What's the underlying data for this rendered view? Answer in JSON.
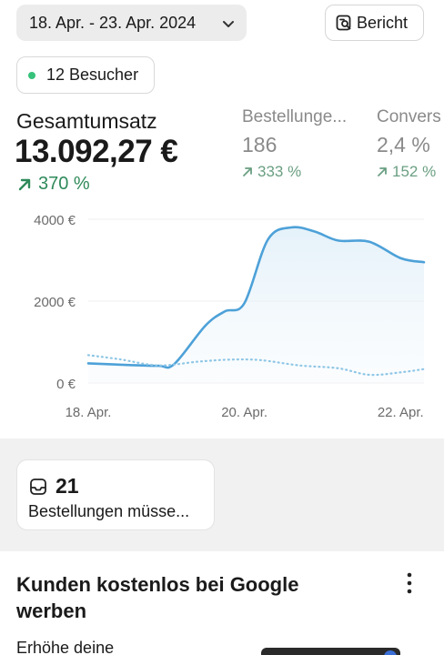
{
  "header": {
    "date_range": "18. Apr. - 23. Apr. 2024",
    "report_label": "Bericht"
  },
  "visitors": {
    "label": "12 Besucher",
    "dot_color": "#36c27a"
  },
  "metrics": {
    "main": {
      "label": "Gesamtumsatz",
      "value": "13.092,27 €",
      "change": "370 %"
    },
    "orders": {
      "label": "Bestellunge...",
      "value": "186",
      "change": "333 %"
    },
    "conversion": {
      "label": "Convers",
      "value": "2,4 %",
      "change": "152 %"
    }
  },
  "chart_data": {
    "type": "line",
    "y_tick_labels": [
      "4000 €",
      "2000 €",
      "0 €"
    ],
    "x_tick_labels": [
      "18. Apr.",
      "20. Apr.",
      "22. Apr."
    ],
    "ylim": [
      0,
      4000
    ],
    "series": [
      {
        "values": [
          [
            0,
            480
          ],
          [
            0.5,
            440
          ],
          [
            0.9,
            420
          ],
          [
            1.1,
            460
          ],
          [
            1.5,
            1400
          ],
          [
            1.75,
            1750
          ],
          [
            2.0,
            1950
          ],
          [
            2.3,
            3500
          ],
          [
            2.6,
            3800
          ],
          [
            2.9,
            3700
          ],
          [
            3.2,
            3480
          ],
          [
            3.6,
            3450
          ],
          [
            4.0,
            3050
          ],
          [
            4.3,
            2950
          ]
        ],
        "color": "#4da1d8",
        "style": "solid"
      },
      {
        "values": [
          [
            0,
            680
          ],
          [
            0.4,
            580
          ],
          [
            0.9,
            430
          ],
          [
            1.4,
            520
          ],
          [
            1.8,
            570
          ],
          [
            2.2,
            560
          ],
          [
            2.7,
            430
          ],
          [
            3.2,
            360
          ],
          [
            3.6,
            200
          ],
          [
            4.0,
            260
          ],
          [
            4.3,
            340
          ]
        ],
        "color": "#8ec6e6",
        "style": "dotted"
      }
    ],
    "grid": true
  },
  "orders_card": {
    "count": "21",
    "text": "Bestellungen müsse..."
  },
  "promo": {
    "title": "Kunden kostenlos bei Google werben",
    "text": "Erhöhe deine"
  }
}
